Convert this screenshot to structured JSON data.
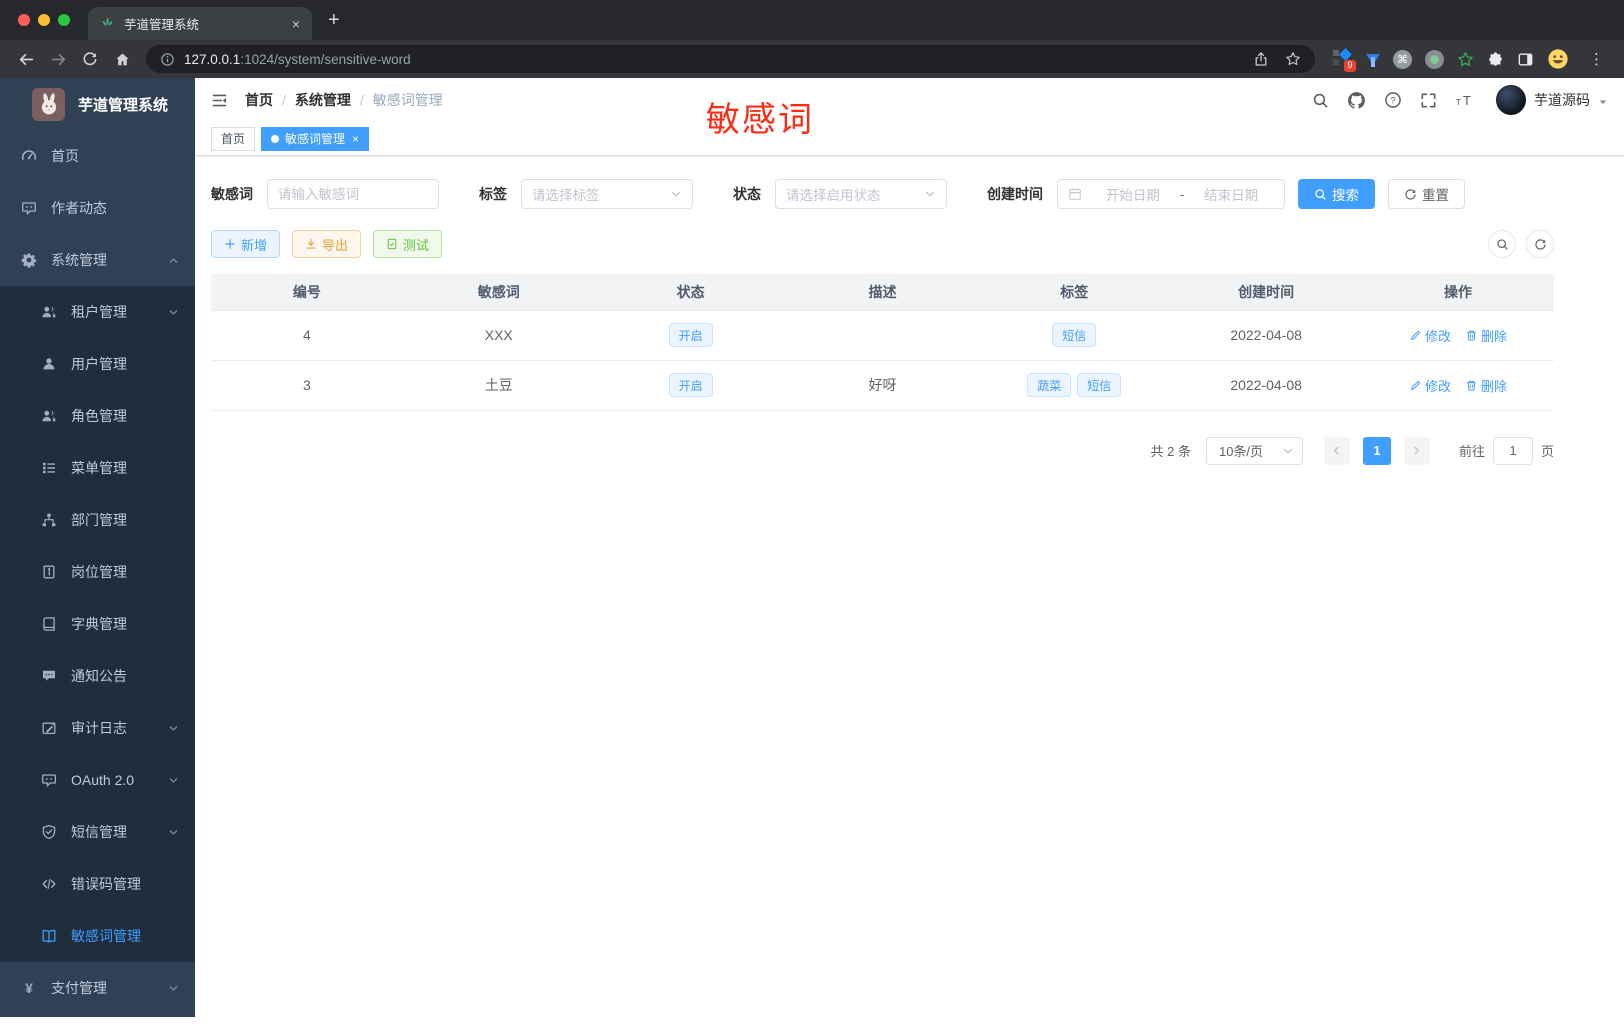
{
  "browser": {
    "tab_title": "芋道管理系统",
    "url": {
      "host": "127.0.0.1",
      "rest": ":1024/system/sensitive-word"
    },
    "extension_badge": "9"
  },
  "sidebar": {
    "logo_title": "芋道管理系统",
    "items": [
      {
        "key": "home",
        "icon": "dashboard-icon",
        "label": "首页",
        "level": "root"
      },
      {
        "key": "author",
        "icon": "author-chat-icon",
        "label": "作者动态",
        "level": "root"
      },
      {
        "key": "system",
        "icon": "gear-icon",
        "label": "系统管理",
        "level": "root",
        "arrow": "up"
      },
      {
        "key": "tenant",
        "icon": "users-icon",
        "label": "租户管理",
        "level": "sub",
        "arrow": "down"
      },
      {
        "key": "user",
        "icon": "user-icon",
        "label": "用户管理",
        "level": "sub"
      },
      {
        "key": "role",
        "icon": "role-users-icon",
        "label": "角色管理",
        "level": "sub"
      },
      {
        "key": "menu",
        "icon": "menu-list-icon",
        "label": "菜单管理",
        "level": "sub"
      },
      {
        "key": "dept",
        "icon": "org-tree-icon",
        "label": "部门管理",
        "level": "sub"
      },
      {
        "key": "post",
        "icon": "post-card-icon",
        "label": "岗位管理",
        "level": "sub"
      },
      {
        "key": "dict",
        "icon": "dictionary-icon",
        "label": "字典管理",
        "level": "sub"
      },
      {
        "key": "notice",
        "icon": "notice-bubble-icon",
        "label": "通知公告",
        "level": "sub"
      },
      {
        "key": "audit",
        "icon": "audit-log-icon",
        "label": "审计日志",
        "level": "sub",
        "arrow": "down"
      },
      {
        "key": "oauth",
        "icon": "oauth-robot-icon",
        "label": "OAuth 2.0",
        "level": "sub",
        "arrow": "down"
      },
      {
        "key": "sms",
        "icon": "shield-check-icon",
        "label": "短信管理",
        "level": "sub",
        "arrow": "down"
      },
      {
        "key": "errcode",
        "icon": "code-icon",
        "label": "错误码管理",
        "level": "sub"
      },
      {
        "key": "sensitive-word",
        "icon": "open-book-icon",
        "label": "敏感词管理",
        "level": "sub",
        "active": true
      },
      {
        "key": "pay",
        "icon": "yen-icon",
        "label": "支付管理",
        "level": "root",
        "arrow": "down"
      }
    ]
  },
  "header": {
    "breadcrumb": [
      {
        "label": "首页"
      },
      {
        "label": "系统管理"
      },
      {
        "label": "敏感词管理",
        "current": true
      }
    ],
    "username": "芋道源码",
    "annotation": "敏感词"
  },
  "tags_view": [
    {
      "label": "首页"
    },
    {
      "label": "敏感词管理",
      "active": true,
      "closable": true
    }
  ],
  "filters": {
    "keyword": {
      "label": "敏感词",
      "placeholder": "请输入敏感词"
    },
    "tag": {
      "label": "标签",
      "placeholder": "请选择标签"
    },
    "status": {
      "label": "状态",
      "placeholder": "请选择启用状态"
    },
    "create_time": {
      "label": "创建时间",
      "start_placeholder": "开始日期",
      "separator": "-",
      "end_placeholder": "结束日期"
    },
    "search_label": "搜索",
    "reset_label": "重置"
  },
  "toolbar": {
    "add_label": "新增",
    "export_label": "导出",
    "test_label": "测试"
  },
  "table": {
    "headers": [
      "编号",
      "敏感词",
      "状态",
      "描述",
      "标签",
      "创建时间",
      "操作"
    ],
    "rows": [
      {
        "id": "4",
        "word": "XXX",
        "status": "开启",
        "description": "",
        "tags": [
          "短信"
        ],
        "created_at": "2022-04-08"
      },
      {
        "id": "3",
        "word": "土豆",
        "status": "开启",
        "description": "好呀",
        "tags": [
          "蔬菜",
          "短信"
        ],
        "created_at": "2022-04-08"
      }
    ],
    "actions": {
      "edit": "修改",
      "delete": "删除"
    }
  },
  "pagination": {
    "total": "共 2 条",
    "page_size": "10条/页",
    "current_page": "1",
    "goto_label": "前往",
    "goto_value": "1",
    "unit_label": "页"
  },
  "colors": {
    "accent": "#409eff",
    "sidebar_bg": "#304156",
    "submenu_bg": "#1f2d3d",
    "annotation_red": "#fe2c17",
    "tag_chip_bg": "#ecf5ff",
    "warning": "#e6a23c",
    "success": "#67c23a"
  }
}
